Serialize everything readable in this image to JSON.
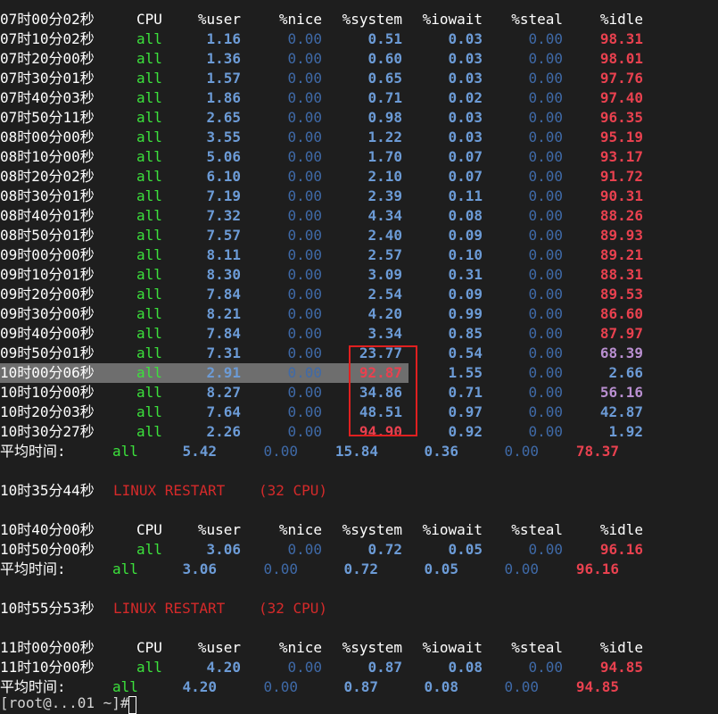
{
  "colors": {
    "background": "#1e1e1e",
    "highlight_row": "#6e6e6e",
    "cpu_all": "#3ce13c",
    "value_blue": "#6c9bd6",
    "value_dim": "#3f6aa8",
    "idle_red": "#e8414f",
    "idle_purple": "#b98fd0",
    "restart_red": "#d52a2a",
    "annotation_box": "#e02020"
  },
  "header": {
    "time": "07时00分02秒",
    "cpu": "CPU",
    "user": "%user",
    "nice": "%nice",
    "system": "%system",
    "iowait": "%iowait",
    "steal": "%steal",
    "idle": "%idle"
  },
  "rows": [
    {
      "time": "07时10分02秒",
      "cpu": "all",
      "user": "1.16",
      "nice": "0.00",
      "system": "0.51",
      "iowait": "0.03",
      "steal": "0.00",
      "idle": "98.31",
      "idle_style": "red"
    },
    {
      "time": "07时20分00秒",
      "cpu": "all",
      "user": "1.36",
      "nice": "0.00",
      "system": "0.60",
      "iowait": "0.03",
      "steal": "0.00",
      "idle": "98.01",
      "idle_style": "red"
    },
    {
      "time": "07时30分01秒",
      "cpu": "all",
      "user": "1.57",
      "nice": "0.00",
      "system": "0.65",
      "iowait": "0.03",
      "steal": "0.00",
      "idle": "97.76",
      "idle_style": "red"
    },
    {
      "time": "07时40分03秒",
      "cpu": "all",
      "user": "1.86",
      "nice": "0.00",
      "system": "0.71",
      "iowait": "0.02",
      "steal": "0.00",
      "idle": "97.40",
      "idle_style": "red"
    },
    {
      "time": "07时50分11秒",
      "cpu": "all",
      "user": "2.65",
      "nice": "0.00",
      "system": "0.98",
      "iowait": "0.03",
      "steal": "0.00",
      "idle": "96.35",
      "idle_style": "red"
    },
    {
      "time": "08时00分00秒",
      "cpu": "all",
      "user": "3.55",
      "nice": "0.00",
      "system": "1.22",
      "iowait": "0.03",
      "steal": "0.00",
      "idle": "95.19",
      "idle_style": "red"
    },
    {
      "time": "08时10分00秒",
      "cpu": "all",
      "user": "5.06",
      "nice": "0.00",
      "system": "1.70",
      "iowait": "0.07",
      "steal": "0.00",
      "idle": "93.17",
      "idle_style": "red"
    },
    {
      "time": "08时20分02秒",
      "cpu": "all",
      "user": "6.10",
      "nice": "0.00",
      "system": "2.10",
      "iowait": "0.07",
      "steal": "0.00",
      "idle": "91.72",
      "idle_style": "red"
    },
    {
      "time": "08时30分01秒",
      "cpu": "all",
      "user": "7.19",
      "nice": "0.00",
      "system": "2.39",
      "iowait": "0.11",
      "steal": "0.00",
      "idle": "90.31",
      "idle_style": "red"
    },
    {
      "time": "08时40分01秒",
      "cpu": "all",
      "user": "7.32",
      "nice": "0.00",
      "system": "4.34",
      "iowait": "0.08",
      "steal": "0.00",
      "idle": "88.26",
      "idle_style": "red"
    },
    {
      "time": "08时50分01秒",
      "cpu": "all",
      "user": "7.57",
      "nice": "0.00",
      "system": "2.40",
      "iowait": "0.09",
      "steal": "0.00",
      "idle": "89.93",
      "idle_style": "red"
    },
    {
      "time": "09时00分00秒",
      "cpu": "all",
      "user": "8.11",
      "nice": "0.00",
      "system": "2.57",
      "iowait": "0.10",
      "steal": "0.00",
      "idle": "89.21",
      "idle_style": "red"
    },
    {
      "time": "09时10分01秒",
      "cpu": "all",
      "user": "8.30",
      "nice": "0.00",
      "system": "3.09",
      "iowait": "0.31",
      "steal": "0.00",
      "idle": "88.31",
      "idle_style": "red"
    },
    {
      "time": "09时20分00秒",
      "cpu": "all",
      "user": "7.84",
      "nice": "0.00",
      "system": "2.54",
      "iowait": "0.09",
      "steal": "0.00",
      "idle": "89.53",
      "idle_style": "red"
    },
    {
      "time": "09时30分00秒",
      "cpu": "all",
      "user": "8.21",
      "nice": "0.00",
      "system": "4.20",
      "iowait": "0.99",
      "steal": "0.00",
      "idle": "86.60",
      "idle_style": "red"
    },
    {
      "time": "09时40分00秒",
      "cpu": "all",
      "user": "7.84",
      "nice": "0.00",
      "system": "3.34",
      "iowait": "0.85",
      "steal": "0.00",
      "idle": "87.97",
      "idle_style": "red"
    },
    {
      "time": "09时50分01秒",
      "cpu": "all",
      "user": "7.31",
      "nice": "0.00",
      "system": "23.77",
      "iowait": "0.54",
      "steal": "0.00",
      "idle": "68.39",
      "idle_style": "purple"
    },
    {
      "time": "10时00分06秒",
      "cpu": "all",
      "user": "2.91",
      "nice": "0.00",
      "system": "92.87",
      "iowait": "1.55",
      "steal": "0.00",
      "idle": "2.66",
      "idle_style": "blue",
      "highlight": true,
      "system_style": "red"
    },
    {
      "time": "10时10分00秒",
      "cpu": "all",
      "user": "8.27",
      "nice": "0.00",
      "system": "34.86",
      "iowait": "0.71",
      "steal": "0.00",
      "idle": "56.16",
      "idle_style": "purple"
    },
    {
      "time": "10时20分03秒",
      "cpu": "all",
      "user": "7.64",
      "nice": "0.00",
      "system": "48.51",
      "iowait": "0.97",
      "steal": "0.00",
      "idle": "42.87",
      "idle_style": "blue"
    },
    {
      "time": "10时30分27秒",
      "cpu": "all",
      "user": "2.26",
      "nice": "0.00",
      "system": "94.90",
      "iowait": "0.92",
      "steal": "0.00",
      "idle": "1.92",
      "idle_style": "blue",
      "system_style": "red"
    }
  ],
  "average1": {
    "label": "平均时间:",
    "cpu": "all",
    "user": "5.42",
    "nice": "0.00",
    "system": "15.84",
    "iowait": "0.36",
    "steal": "0.00",
    "idle": "78.37"
  },
  "restart1": {
    "time": "10时35分44秒",
    "text": "LINUX RESTART",
    "cpus": "(32 CPU)"
  },
  "header2": {
    "time": "10时40分00秒",
    "cpu": "CPU",
    "user": "%user",
    "nice": "%nice",
    "system": "%system",
    "iowait": "%iowait",
    "steal": "%steal",
    "idle": "%idle"
  },
  "row2": {
    "time": "10时50分00秒",
    "cpu": "all",
    "user": "3.06",
    "nice": "0.00",
    "system": "0.72",
    "iowait": "0.05",
    "steal": "0.00",
    "idle": "96.16"
  },
  "average2": {
    "label": "平均时间:",
    "cpu": "all",
    "user": "3.06",
    "nice": "0.00",
    "system": "0.72",
    "iowait": "0.05",
    "steal": "0.00",
    "idle": "96.16"
  },
  "restart2": {
    "time": "10时55分53秒",
    "text": "LINUX RESTART",
    "cpus": "(32 CPU)"
  },
  "header3": {
    "time": "11时00分00秒",
    "cpu": "CPU",
    "user": "%user",
    "nice": "%nice",
    "system": "%system",
    "iowait": "%iowait",
    "steal": "%steal",
    "idle": "%idle"
  },
  "row3": {
    "time": "11时10分00秒",
    "cpu": "all",
    "user": "4.20",
    "nice": "0.00",
    "system": "0.87",
    "iowait": "0.08",
    "steal": "0.00",
    "idle": "94.85"
  },
  "average3": {
    "label": "平均时间:",
    "cpu": "all",
    "user": "4.20",
    "nice": "0.00",
    "system": "0.87",
    "iowait": "0.08",
    "steal": "0.00",
    "idle": "94.85"
  },
  "prompt": "[root@...01 ~]# "
}
